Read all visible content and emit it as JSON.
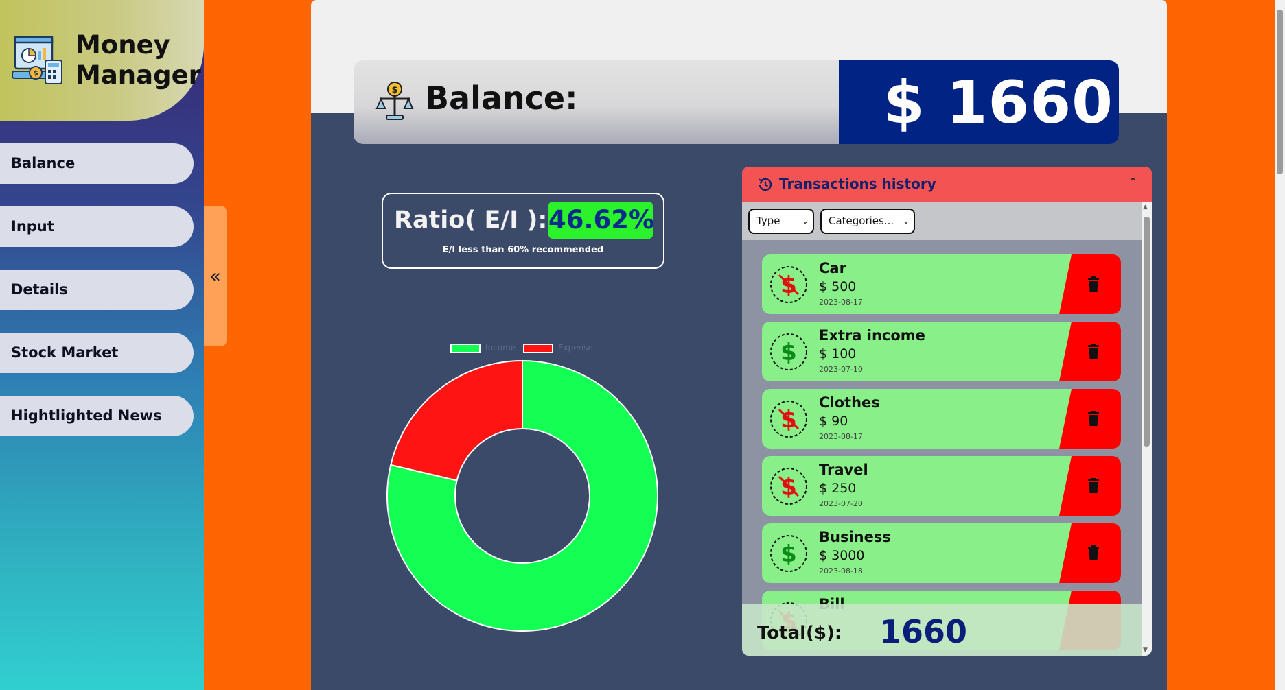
{
  "app": {
    "title": "Money Manager",
    "icon": "finance-dashboard-icon"
  },
  "sidebar": {
    "items": [
      {
        "label": "Balance"
      },
      {
        "label": "Input"
      },
      {
        "label": "Details"
      },
      {
        "label": "Stock Market"
      },
      {
        "label": "Hightlighted News"
      }
    ],
    "collapse_glyph": "«"
  },
  "balance": {
    "label": "Balance:",
    "value": "$ 1660",
    "icon": "scale-icon"
  },
  "ratio": {
    "label": "Ratio( E/I ):",
    "value": "46.62%",
    "note": "E/I less than 60% recommended"
  },
  "chart_data": {
    "type": "pie",
    "variant": "doughnut",
    "categories": [
      "Income",
      "Expense"
    ],
    "values": [
      3100,
      840
    ],
    "colors": [
      "#13ff53",
      "#ff1414"
    ],
    "legend": "top"
  },
  "transactions": {
    "title": "Transactions history",
    "filters": {
      "type": "Type",
      "category": "Categories..."
    },
    "items": [
      {
        "name": "Car",
        "amount": "$ 500",
        "date": "2023-08-17",
        "kind": "expense"
      },
      {
        "name": "Extra income",
        "amount": "$ 100",
        "date": "2023-07-10",
        "kind": "income"
      },
      {
        "name": "Clothes",
        "amount": "$ 90",
        "date": "2023-08-17",
        "kind": "expense"
      },
      {
        "name": "Travel",
        "amount": "$ 250",
        "date": "2023-07-20",
        "kind": "expense"
      },
      {
        "name": "Business",
        "amount": "$ 3000",
        "date": "2023-08-18",
        "kind": "income"
      },
      {
        "name": "Bill",
        "amount": "",
        "date": "",
        "kind": "expense"
      }
    ],
    "total_label": "Total($):",
    "total_value": "1660"
  },
  "colors": {
    "background": "#ff6503",
    "panel": "#3c4a6a",
    "income": "#13ff53",
    "expense": "#ff1414",
    "accent_blue": "#012383"
  }
}
